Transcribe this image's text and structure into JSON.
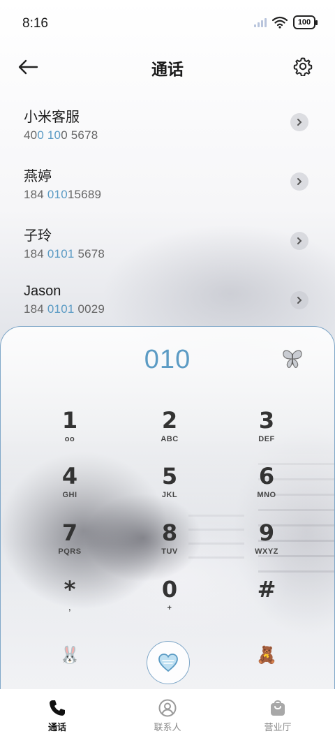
{
  "status_bar": {
    "time": "8:16",
    "battery": "100",
    "icons": [
      "signal-icon",
      "wifi-icon",
      "battery-icon"
    ]
  },
  "header": {
    "title": "通话",
    "back_icon": "arrow-left-icon",
    "settings_icon": "gear-icon"
  },
  "contacts": [
    {
      "name": "小米客服",
      "num_parts": [
        "40",
        "0 10",
        "0 5678"
      ]
    },
    {
      "name": "燕婷",
      "num_parts": [
        "184 ",
        "010",
        "15689"
      ]
    },
    {
      "name": "子玲",
      "num_parts": [
        "184 ",
        "0101",
        " 5678"
      ]
    },
    {
      "name": "Jason",
      "num_parts": [
        "184 ",
        "0101",
        " 0029"
      ]
    }
  ],
  "dialer": {
    "input": "010",
    "keys": [
      {
        "digit": "1",
        "letters": "oo"
      },
      {
        "digit": "2",
        "letters": "ABC"
      },
      {
        "digit": "3",
        "letters": "DEF"
      },
      {
        "digit": "4",
        "letters": "GHI"
      },
      {
        "digit": "5",
        "letters": "JKL"
      },
      {
        "digit": "6",
        "letters": "MNO"
      },
      {
        "digit": "7",
        "letters": "PQRS"
      },
      {
        "digit": "8",
        "letters": "TUV"
      },
      {
        "digit": "9",
        "letters": "WXYZ"
      },
      {
        "digit": "*",
        "letters": ","
      },
      {
        "digit": "0",
        "letters": "+"
      },
      {
        "digit": "#",
        "letters": ""
      }
    ],
    "emojis": {
      "left": "🐰",
      "right": "🧸"
    }
  },
  "nav": {
    "items": [
      {
        "label": "通话",
        "active": true
      },
      {
        "label": "联系人",
        "active": false
      },
      {
        "label": "营业厅",
        "active": false
      }
    ]
  },
  "colors": {
    "accent": "#5b9bc4",
    "border": "#7fa7c8"
  }
}
